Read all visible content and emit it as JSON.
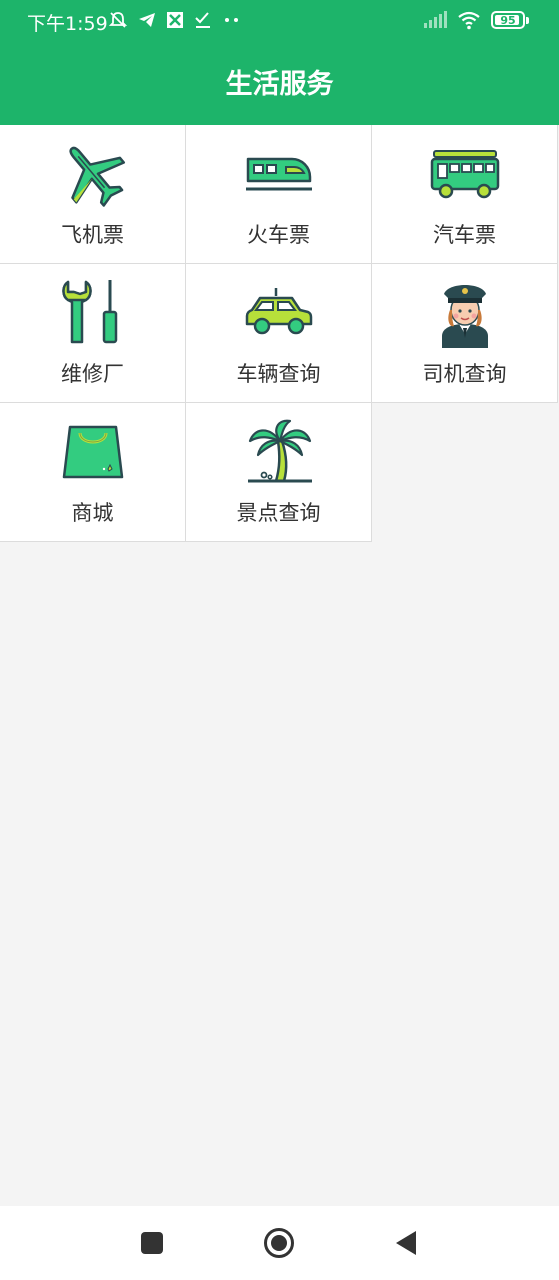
{
  "status_bar": {
    "time": "下午1:59",
    "battery": "95"
  },
  "header": {
    "title": "生活服务"
  },
  "services": [
    {
      "label": "飞机票",
      "icon": "airplane-icon"
    },
    {
      "label": "火车票",
      "icon": "train-icon"
    },
    {
      "label": "汽车票",
      "icon": "bus-icon"
    },
    {
      "label": "维修厂",
      "icon": "repair-tools-icon"
    },
    {
      "label": "车辆查询",
      "icon": "car-icon"
    },
    {
      "label": "司机查询",
      "icon": "driver-icon"
    },
    {
      "label": "商城",
      "icon": "shopping-bag-icon"
    },
    {
      "label": "景点查询",
      "icon": "palm-tree-icon"
    }
  ],
  "colors": {
    "brand": "#1db46a",
    "icon_green": "#33cc80",
    "icon_lime": "#b7e03a",
    "outline": "#2a4a50"
  },
  "nav": {
    "buttons": [
      "recent-apps",
      "home",
      "back"
    ]
  }
}
